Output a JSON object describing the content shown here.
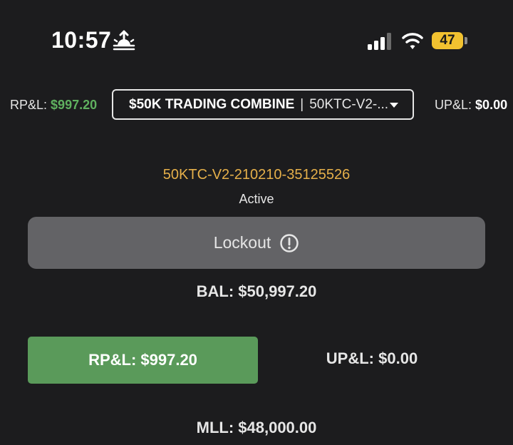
{
  "status_bar": {
    "time": "10:57",
    "battery_level": "47",
    "icons": [
      "sunrise-icon",
      "cellular-signal-icon",
      "wifi-icon",
      "battery-icon"
    ],
    "battery_color": "#f2c230"
  },
  "header": {
    "rpl_label": "RP&L:",
    "rpl_value": "$997.20",
    "upl_label": "UP&L:",
    "upl_value": "$0.00",
    "account_name": "$50K TRADING COMBINE",
    "separator": "|",
    "account_short": "50KTC-V2-..."
  },
  "account": {
    "id": "50KTC-V2-210210-35125526",
    "status": "Active"
  },
  "lockout": {
    "label": "Lockout",
    "icon": "alert-circle-icon"
  },
  "stats": {
    "balance": "BAL: $50,997.20",
    "rpl": "RP&L: $997.20",
    "upl": "UP&L: $0.00",
    "mll": "MLL: $48,000.00"
  },
  "colors": {
    "background": "#1c1c1e",
    "positive": "#5fb05f",
    "rpl_button": "#5a9a5a",
    "account_id": "#e6b04a",
    "lockout_button": "#636366"
  }
}
